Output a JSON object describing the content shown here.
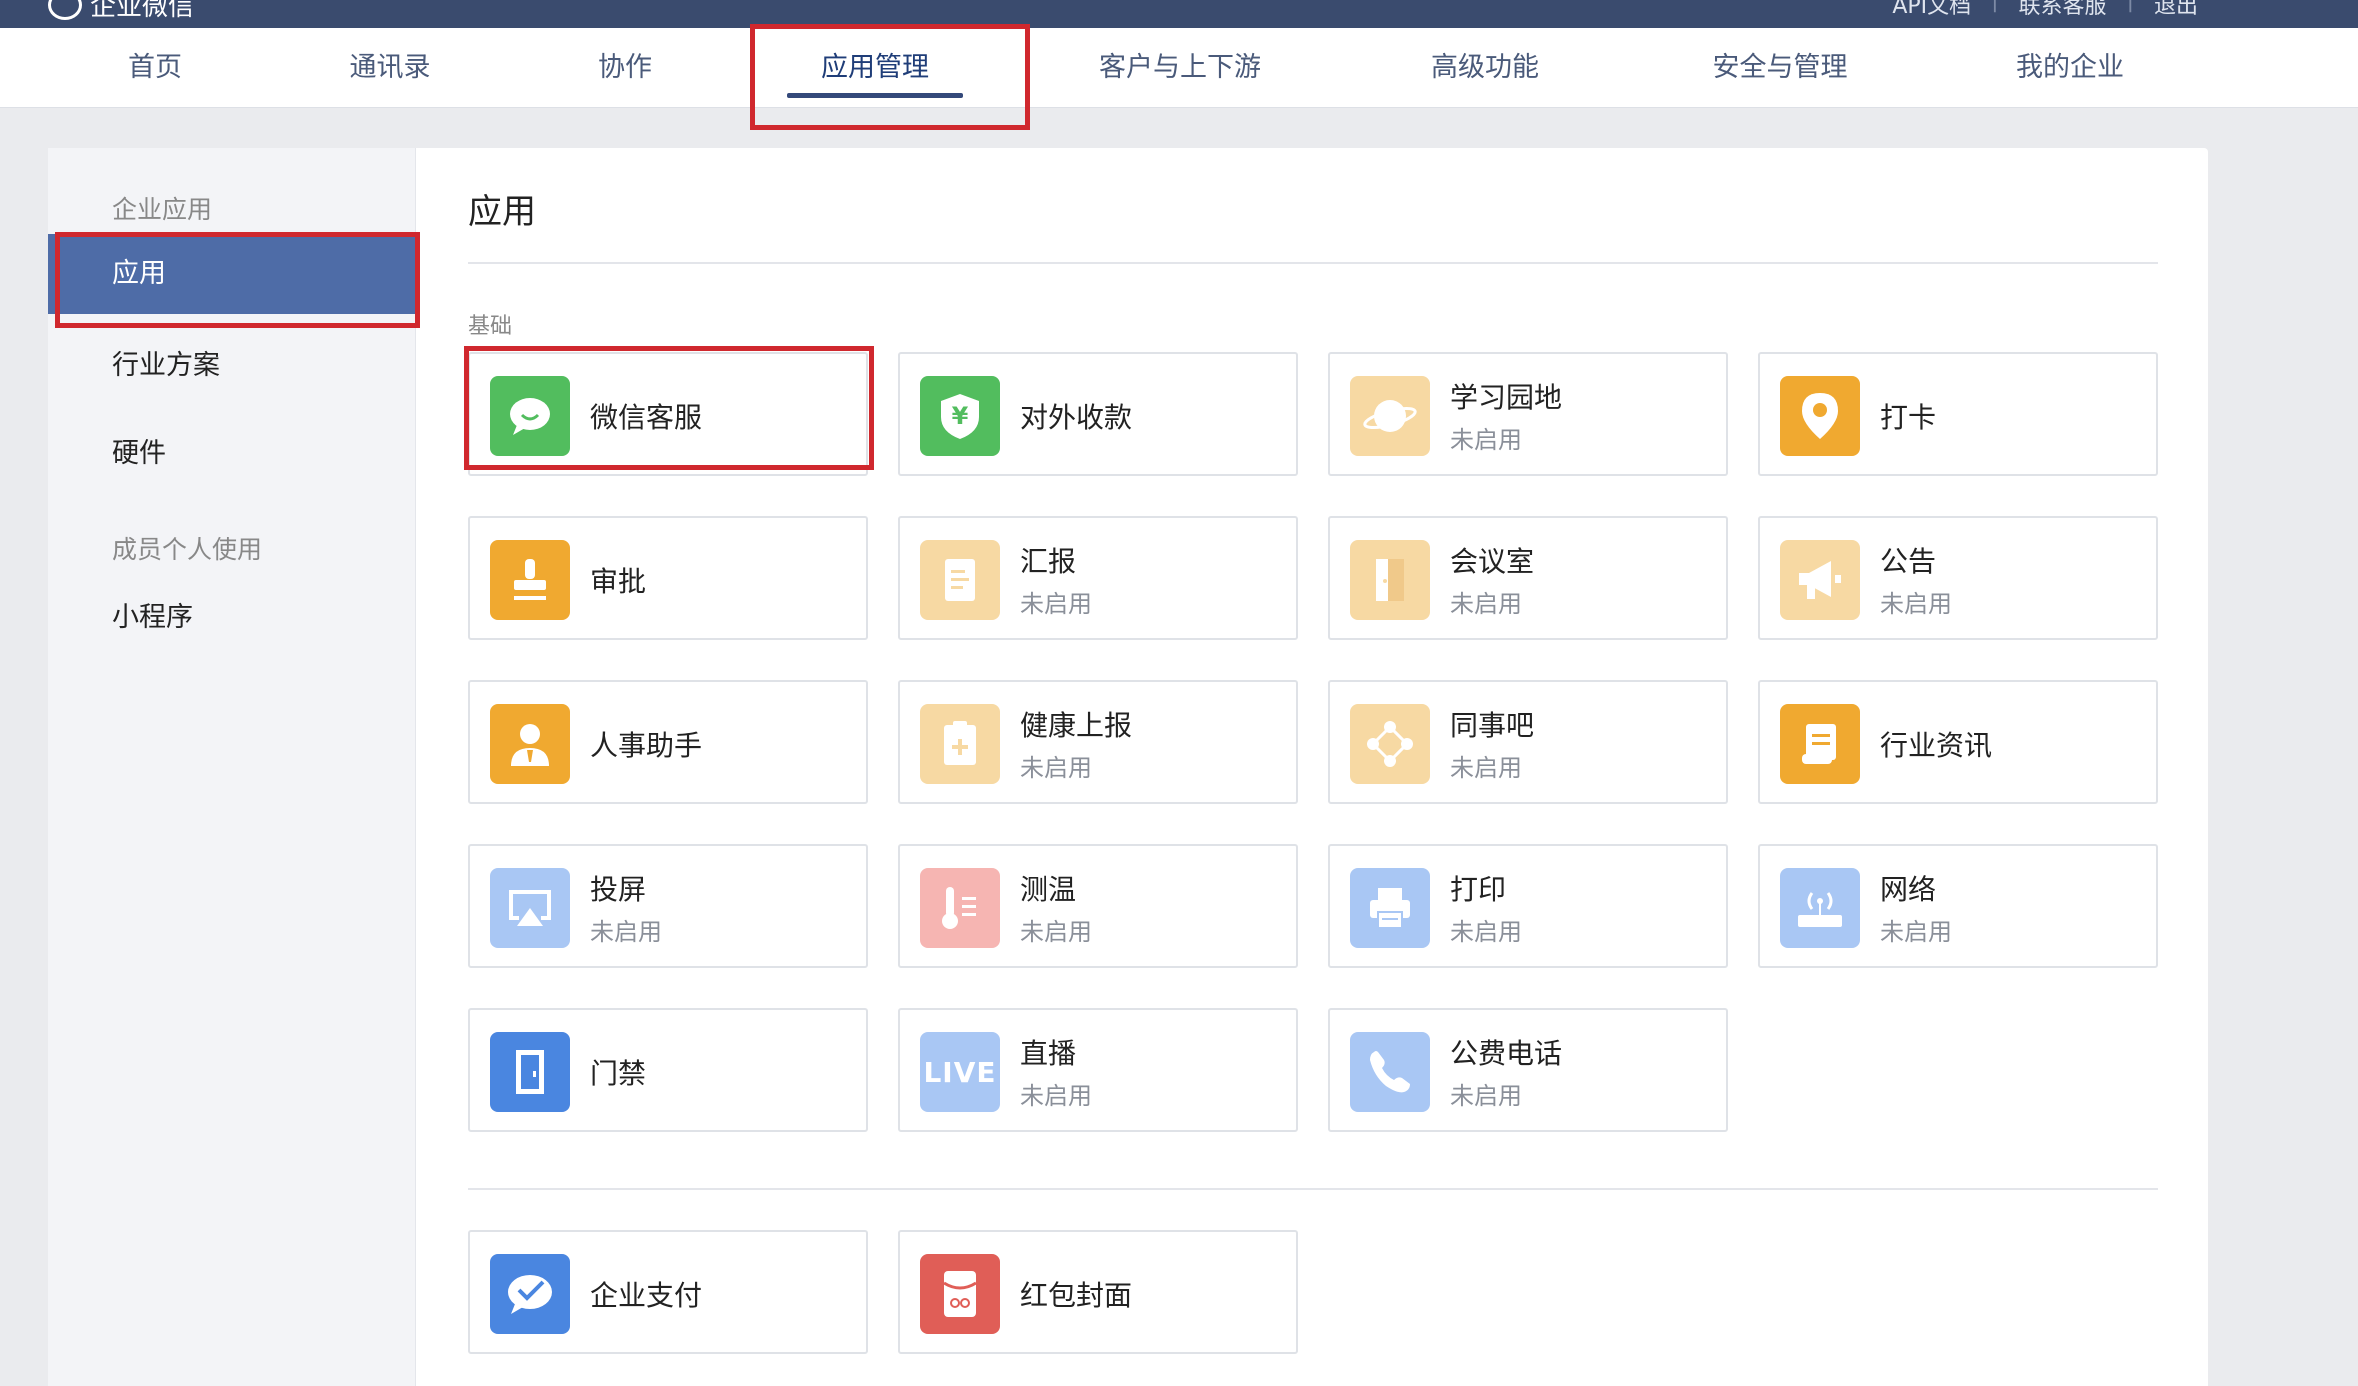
{
  "header": {
    "logo_text": "企业微信",
    "links": [
      "API文档",
      "联系客服",
      "退出"
    ]
  },
  "nav": {
    "items": [
      "首页",
      "通讯录",
      "协作",
      "应用管理",
      "客户与上下游",
      "高级功能",
      "安全与管理",
      "我的企业"
    ],
    "active": "应用管理"
  },
  "sidebar": {
    "section1": "企业应用",
    "items1": [
      "应用",
      "行业方案",
      "硬件"
    ],
    "section2": "成员个人使用",
    "items2": [
      "小程序"
    ]
  },
  "main": {
    "title": "应用",
    "group_label": "基础",
    "apps": [
      {
        "name": "微信客服",
        "status": "",
        "icon": "chat-bubble-icon",
        "color": "#52bd5e"
      },
      {
        "name": "对外收款",
        "status": "",
        "icon": "yuan-shield-icon",
        "color": "#52bd5e"
      },
      {
        "name": "学习园地",
        "status": "未启用",
        "icon": "planet-icon",
        "color": "#f7d9a3"
      },
      {
        "name": "打卡",
        "status": "",
        "icon": "location-pin-icon",
        "color": "#f0a930"
      },
      {
        "name": "审批",
        "status": "",
        "icon": "stamp-icon",
        "color": "#f0a930"
      },
      {
        "name": "汇报",
        "status": "未启用",
        "icon": "report-doc-icon",
        "color": "#f7d9a3"
      },
      {
        "name": "会议室",
        "status": "未启用",
        "icon": "door-icon",
        "color": "#f7d9a3"
      },
      {
        "name": "公告",
        "status": "未启用",
        "icon": "megaphone-icon",
        "color": "#f7d9a3"
      },
      {
        "name": "人事助手",
        "status": "",
        "icon": "person-tie-icon",
        "color": "#f0a930"
      },
      {
        "name": "健康上报",
        "status": "未启用",
        "icon": "clipboard-plus-icon",
        "color": "#f7d9a3"
      },
      {
        "name": "同事吧",
        "status": "未启用",
        "icon": "network-nodes-icon",
        "color": "#f7d9a3"
      },
      {
        "name": "行业资讯",
        "status": "",
        "icon": "scroll-doc-icon",
        "color": "#f0a930"
      },
      {
        "name": "投屏",
        "status": "未启用",
        "icon": "airplay-icon",
        "color": "#a9c7f4"
      },
      {
        "name": "测温",
        "status": "未启用",
        "icon": "thermometer-icon",
        "color": "#f6b5b2"
      },
      {
        "name": "打印",
        "status": "未启用",
        "icon": "printer-icon",
        "color": "#a9c7f4"
      },
      {
        "name": "网络",
        "status": "未启用",
        "icon": "router-icon",
        "color": "#a9c7f4"
      },
      {
        "name": "门禁",
        "status": "",
        "icon": "door-access-icon",
        "color": "#4a86e0"
      },
      {
        "name": "直播",
        "status": "未启用",
        "icon": "live-icon",
        "icon_text": "LIVE",
        "color": "#a9c7f4"
      },
      {
        "name": "公费电话",
        "status": "未启用",
        "icon": "phone-icon",
        "color": "#a9c7f4"
      }
    ],
    "apps2": [
      {
        "name": "企业支付",
        "status": "",
        "icon": "pay-bubble-icon",
        "color": "#4a86e0"
      },
      {
        "name": "红包封面",
        "status": "",
        "icon": "red-envelope-icon",
        "color": "#e05e57"
      }
    ]
  }
}
